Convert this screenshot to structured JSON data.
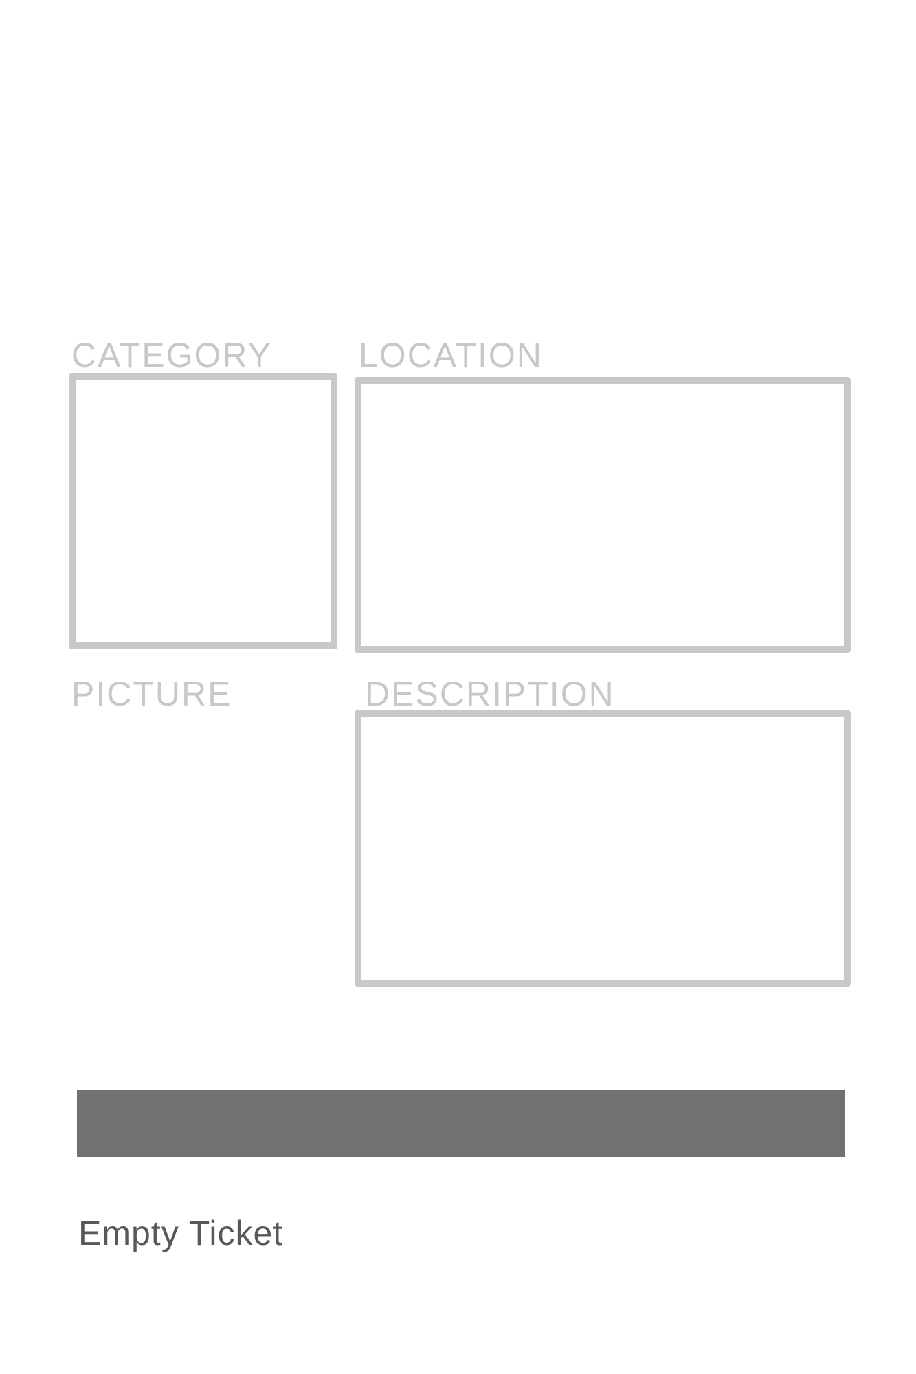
{
  "form": {
    "category": {
      "label": "CATEGORY",
      "value": ""
    },
    "location": {
      "label": "LOCATION",
      "value": ""
    },
    "picture": {
      "label": "PICTURE"
    },
    "description": {
      "label": "DESCRIPTION",
      "value": ""
    },
    "submit": {
      "label": ""
    }
  },
  "footer": {
    "caption": "Empty Ticket"
  },
  "colors": {
    "field_border": "#c8c8c8",
    "label_text": "#c8c8c8",
    "submit_bar": "#717173",
    "caption_text": "#58585a",
    "background": "#ffffff"
  }
}
